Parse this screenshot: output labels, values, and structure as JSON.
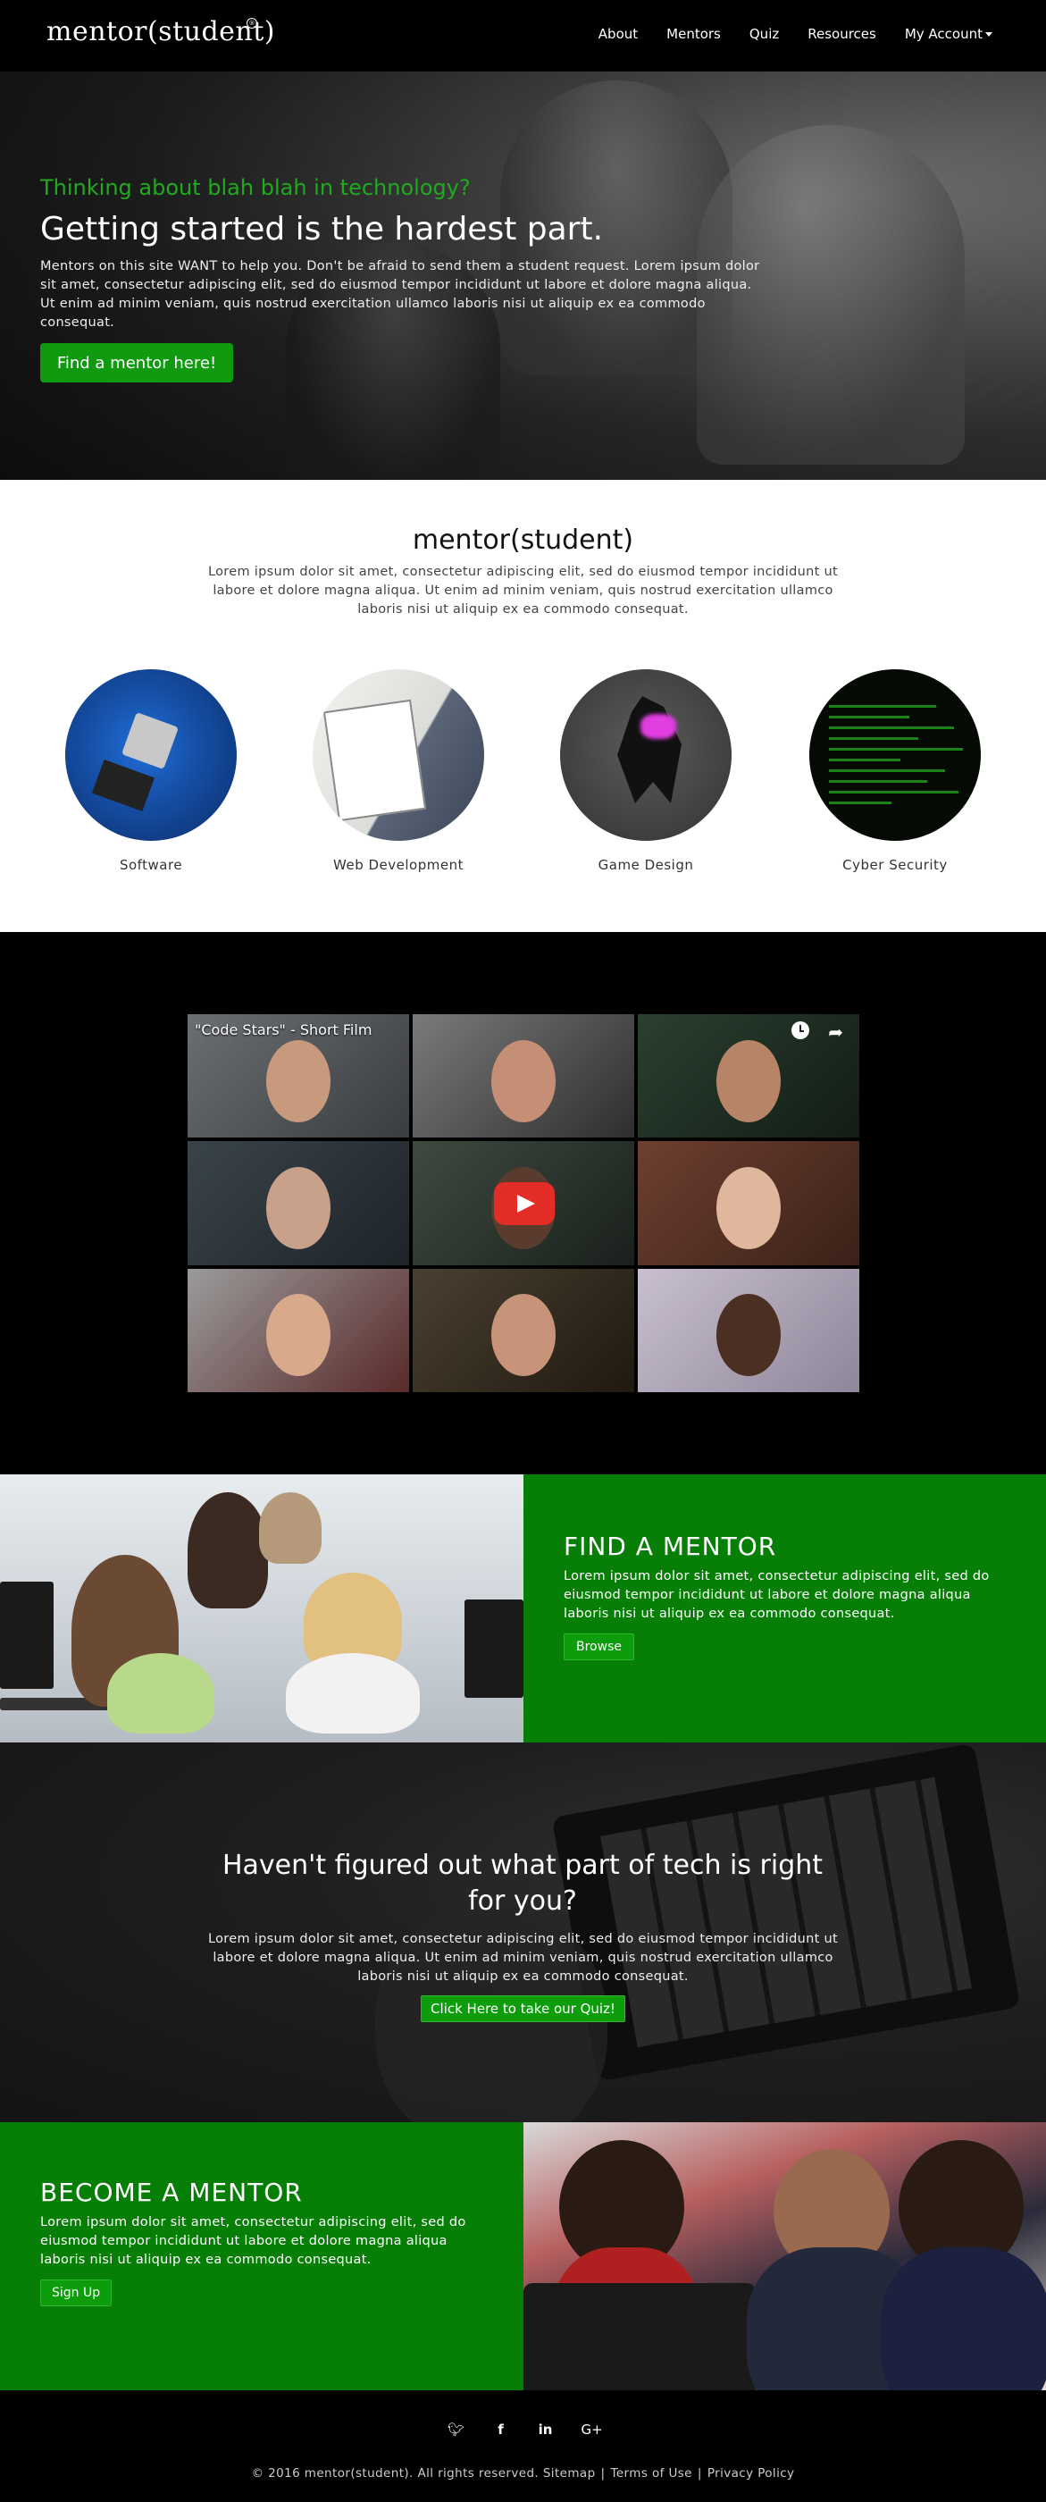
{
  "nav": {
    "logo": "mentor(student)",
    "logo_mark": "®",
    "items": [
      "About",
      "Mentors",
      "Quiz",
      "Resources",
      "My Account"
    ]
  },
  "hero": {
    "kicker": "Thinking about blah blah in technology?",
    "title": "Getting started is the hardest part.",
    "text": "Mentors on this site WANT to help you. Don't be afraid to send them a student request. Lorem ipsum dolor sit amet, consectetur adipiscing elit, sed do eiusmod tempor incididunt ut labore et dolore magna aliqua. Ut enim ad minim veniam, quis nostrud exercitation ullamco laboris nisi ut aliquip ex ea commodo consequat.",
    "cta": "Find a mentor here!"
  },
  "about": {
    "title": "mentor(student)",
    "text": "Lorem ipsum dolor sit amet, consectetur adipiscing elit, sed do eiusmod tempor incididunt ut labore et dolore magna aliqua. Ut enim ad minim veniam, quis nostrud exercitation ullamco laboris nisi ut aliquip ex ea commodo consequat.",
    "categories": [
      {
        "label": "Software",
        "icon": "circuit-board-image"
      },
      {
        "label": "Web Development",
        "icon": "wireframe-sketch-image"
      },
      {
        "label": "Game Design",
        "icon": "3d-model-image"
      },
      {
        "label": "Cyber Security",
        "icon": "terminal-code-image"
      }
    ]
  },
  "video": {
    "title": "\"Code Stars\" - Short Film",
    "icons": [
      "watch-later-icon",
      "share-icon",
      "play-button-icon"
    ]
  },
  "find_mentor": {
    "title": "FIND A MENTOR",
    "text": "Lorem ipsum dolor sit amet, consectetur adipiscing elit, sed do eiusmod tempor incididunt ut labore et dolore magna aliqua laboris nisi ut aliquip ex ea commodo consequat.",
    "button": "Browse"
  },
  "quiz": {
    "title": "Haven't figured out what part of tech is right for you?",
    "text": "Lorem ipsum dolor sit amet, consectetur adipiscing elit, sed do eiusmod tempor incididunt ut labore et dolore magna aliqua. Ut enim ad minim veniam, quis nostrud exercitation ullamco laboris nisi ut aliquip ex ea commodo consequat.",
    "button": "Click Here to take our Quiz!"
  },
  "become_mentor": {
    "title": "BECOME A MENTOR",
    "text": "Lorem ipsum dolor sit amet, consectetur adipiscing elit, sed do eiusmod tempor incididunt ut labore et dolore magna aliqua laboris nisi ut aliquip ex ea commodo consequat.",
    "button": "Sign Up"
  },
  "footer": {
    "social": [
      "twitter-icon",
      "facebook-icon",
      "linkedin-icon",
      "google-plus-icon"
    ],
    "copyright": "© 2016 mentor(student). All rights reserved.",
    "links": [
      "Sitemap",
      "Terms of Use",
      "Privacy Policy"
    ],
    "separator": "|"
  },
  "colors": {
    "brand_green": "#077f07",
    "button_green": "#0f9a0f",
    "kicker_green": "#1faa1f",
    "youtube_red": "#e52d27"
  }
}
